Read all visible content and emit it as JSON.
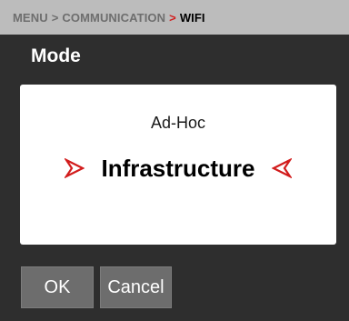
{
  "breadcrumb": {
    "items": [
      "MENU",
      "COMMUNICATION",
      "WIFI"
    ],
    "separator": ">"
  },
  "title": "Mode",
  "options": [
    {
      "label": "Ad-Hoc",
      "selected": false
    },
    {
      "label": "Infrastructure",
      "selected": true
    }
  ],
  "icons": {
    "left": "selector-arrow-right-icon",
    "right": "selector-arrow-left-icon"
  },
  "buttons": {
    "ok_label": "OK",
    "cancel_label": "Cancel"
  },
  "colors": {
    "accent": "#d21c1c",
    "background": "#2e2e2e",
    "breadcrumb_bg": "#bcbcbc",
    "button_bg": "#6d6d6d"
  }
}
